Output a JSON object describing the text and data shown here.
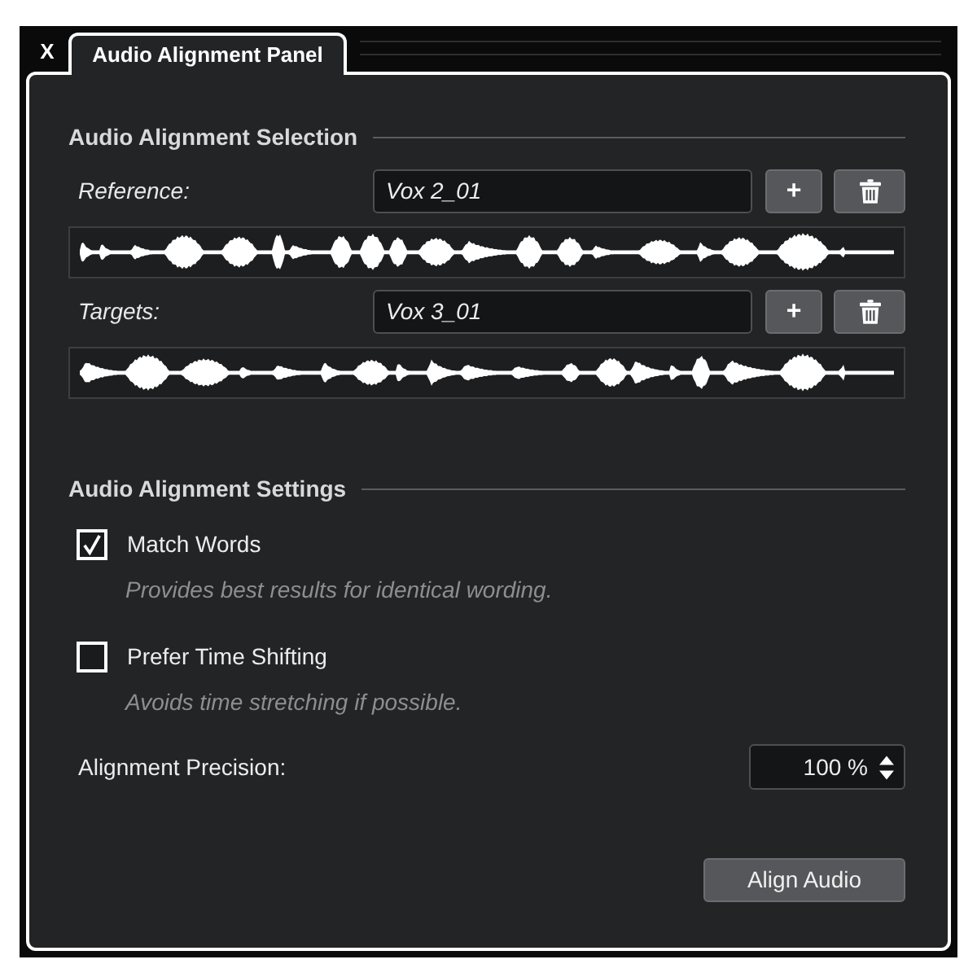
{
  "window": {
    "close_label": "X",
    "tabs": [
      {
        "label": "Audio Alignment Panel",
        "selected": true
      }
    ]
  },
  "selection": {
    "title": "Audio Alignment Selection",
    "tracks": [
      {
        "label": "Reference:",
        "value": "Vox 2_01",
        "add_label": "+"
      },
      {
        "label": "Targets:",
        "value": "Vox 3_01",
        "add_label": "+"
      }
    ]
  },
  "settings": {
    "title": "Audio Alignment Settings",
    "options": [
      {
        "label": "Match Words",
        "description": "Provides best results for identical wording.",
        "checked": true
      },
      {
        "label": "Prefer Time Shifting",
        "description": "Avoids time stretching if possible.",
        "checked": false
      }
    ],
    "precision": {
      "label": "Alignment Precision:",
      "value": "100 %"
    }
  },
  "align_button": {
    "label": "Align Audio"
  }
}
